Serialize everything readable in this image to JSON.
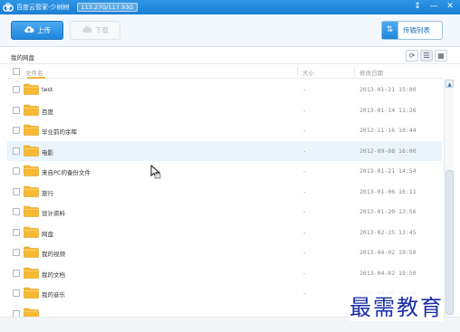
{
  "window": {
    "title": "百度云管家-少树树",
    "quota": "113.27G/117.93G",
    "controls": [
      "↕",
      "—",
      "✕"
    ]
  },
  "toolbar": {
    "upload_label": "上传",
    "download_label": "下载",
    "transfer_label": "传输列表"
  },
  "path": {
    "breadcrumb": "我的网盘"
  },
  "columns": {
    "name": "文件名",
    "size": "大小",
    "modified": "修改日期"
  },
  "files": [
    {
      "name": "test",
      "size": "-",
      "modified": "2013-01-21 15:00"
    },
    {
      "name": "百度",
      "size": "-",
      "modified": "2013-01-14 11:26"
    },
    {
      "name": "毕业前的余晖",
      "size": "-",
      "modified": "2012-11-16 10:44"
    },
    {
      "name": "电影",
      "size": "-",
      "modified": "2012-09-08 16:00"
    },
    {
      "name": "来自PC的备份文件",
      "size": "-",
      "modified": "2013-01-21 14:54"
    },
    {
      "name": "旅行",
      "size": "-",
      "modified": "2013-01-06 16:11"
    },
    {
      "name": "设计资料",
      "size": "-",
      "modified": "2013-01-20 13:56"
    },
    {
      "name": "网盘",
      "size": "-",
      "modified": "2013-02-25 13:45"
    },
    {
      "name": "我的视频",
      "size": "-",
      "modified": "2013-04-02 19:50"
    },
    {
      "name": "我的文档",
      "size": "-",
      "modified": "2013-04-02 19:50"
    },
    {
      "name": "我的音乐",
      "size": "-",
      "modified": "2013-04-02 19:50"
    },
    {
      "name": "",
      "size": "",
      "modified": ""
    }
  ],
  "selected_row": 3,
  "watermark": "最需教育",
  "colors": {
    "accent": "#1f86db",
    "folder": "#f7b932",
    "selected_row": "#eaf4fc"
  }
}
